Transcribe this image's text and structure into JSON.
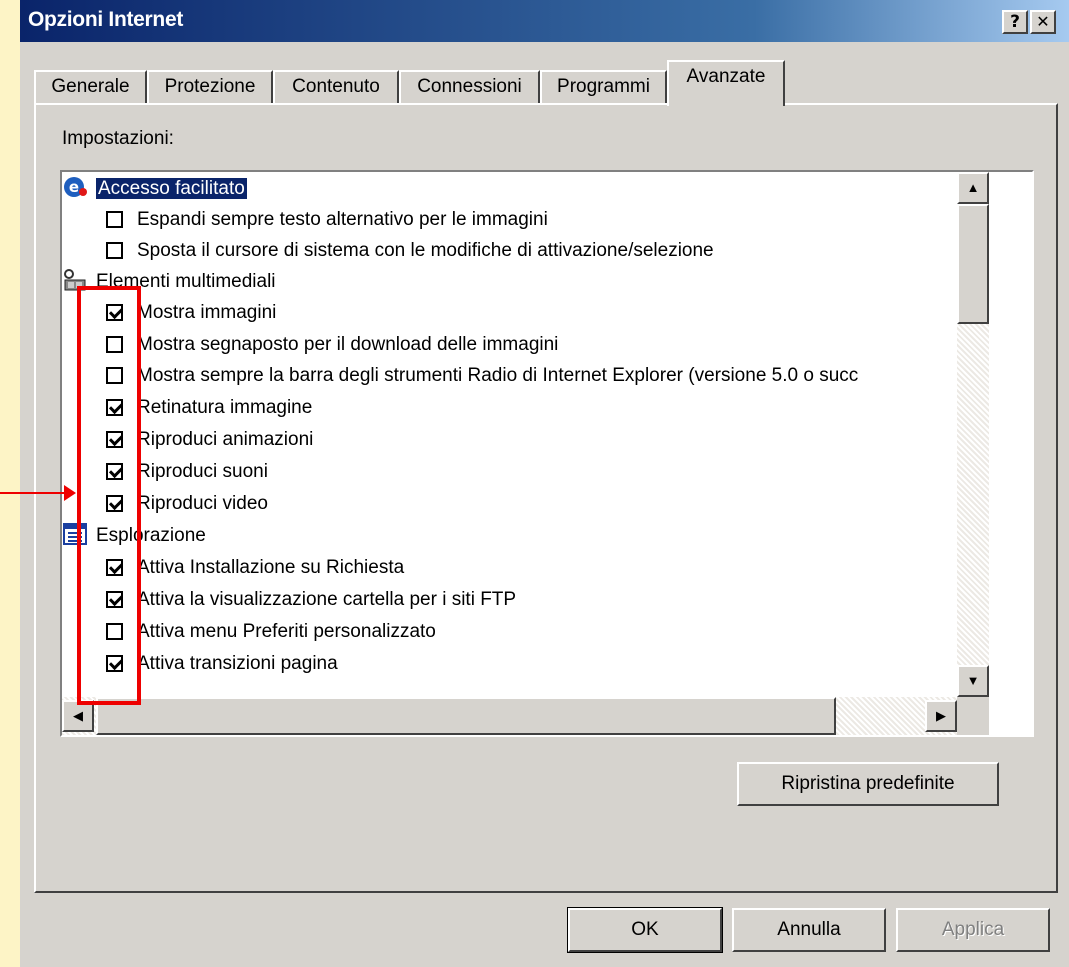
{
  "window": {
    "title": "Opzioni Internet",
    "help_glyph": "?",
    "close_glyph": "✕"
  },
  "tabs": [
    {
      "label": "Generale"
    },
    {
      "label": "Protezione"
    },
    {
      "label": "Contenuto"
    },
    {
      "label": "Connessioni"
    },
    {
      "label": "Programmi"
    },
    {
      "label": "Avanzate",
      "active": true
    }
  ],
  "settings": {
    "label": "Impostazioni:",
    "groups": [
      {
        "label": "Accesso facilitato",
        "icon": "accessibility-icon",
        "selected": true,
        "items": [
          {
            "label": "Espandi sempre testo alternativo per le immagini",
            "checked": false
          },
          {
            "label": "Sposta il cursore di sistema con le modifiche di attivazione/selezione",
            "checked": false
          }
        ]
      },
      {
        "label": "Elementi multimediali",
        "icon": "multimedia-icon",
        "items": [
          {
            "label": "Mostra immagini",
            "checked": true
          },
          {
            "label": "Mostra segnaposto per il download delle immagini",
            "checked": false
          },
          {
            "label": "Mostra sempre la barra degli strumenti  Radio di Internet Explorer (versione 5.0 o succ",
            "checked": false
          },
          {
            "label": "Retinatura immagine",
            "checked": true
          },
          {
            "label": "Riproduci animazioni",
            "checked": true
          },
          {
            "label": "Riproduci suoni",
            "checked": true
          },
          {
            "label": "Riproduci video",
            "checked": true
          }
        ]
      },
      {
        "label": "Esplorazione",
        "icon": "browsing-icon",
        "items": [
          {
            "label": "Attiva Installazione su Richiesta",
            "checked": true
          },
          {
            "label": "Attiva la visualizzazione cartella per i siti FTP",
            "checked": true
          },
          {
            "label": "Attiva menu Preferiti personalizzato",
            "checked": false
          },
          {
            "label": "Attiva transizioni pagina",
            "checked": true
          }
        ]
      }
    ]
  },
  "scroll_glyphs": {
    "up": "▲",
    "down": "▼",
    "left": "◀",
    "right": "▶"
  },
  "buttons": {
    "restore": "Ripristina predefinite",
    "ok": "OK",
    "cancel": "Annulla",
    "apply": "Applica"
  },
  "colors": {
    "highlight": "#ee0000",
    "selection": "#0a246a",
    "background": "#fdf4c6"
  }
}
